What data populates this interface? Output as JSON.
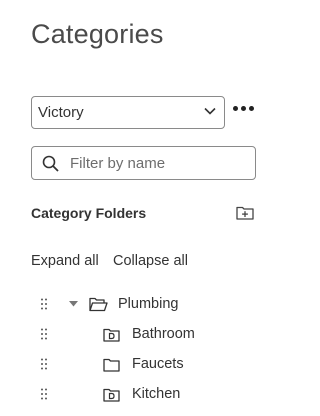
{
  "page": {
    "title": "Categories"
  },
  "selector": {
    "value": "Victory"
  },
  "search": {
    "placeholder": "Filter by name"
  },
  "section": {
    "title": "Category Folders"
  },
  "actions": {
    "expand_all": "Expand all",
    "collapse_all": "Collapse all"
  },
  "tree": {
    "items": [
      {
        "label": "Plumbing",
        "icon": "folder-open-icon",
        "expanded": true,
        "level": 0
      },
      {
        "label": "Bathroom",
        "icon": "folder-d-icon",
        "level": 1
      },
      {
        "label": "Faucets",
        "icon": "folder-icon",
        "level": 1
      },
      {
        "label": "Kitchen",
        "icon": "folder-d-icon",
        "level": 1
      }
    ]
  }
}
